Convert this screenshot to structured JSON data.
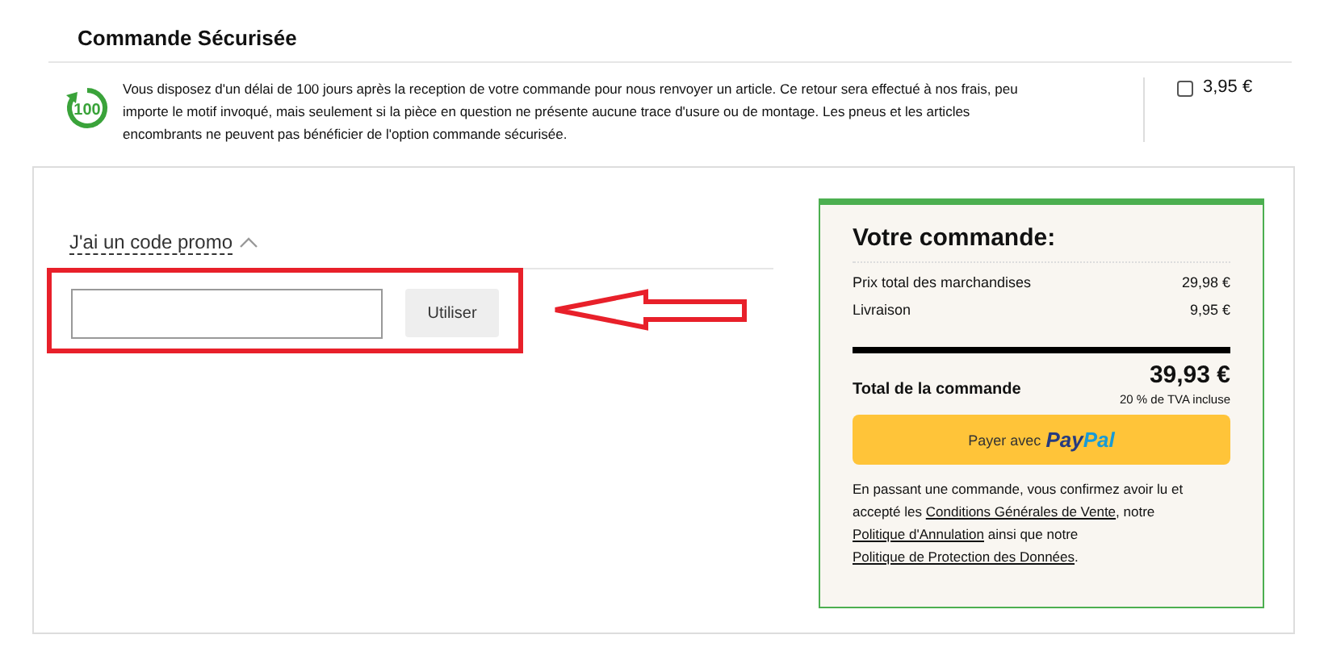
{
  "secure_order": {
    "title": "Commande Sécurisée",
    "badge": "100",
    "description": "Vous disposez d'un délai de 100 jours après la reception de votre commande pour nous renvoyer un article. Ce retour sera effectué à nos frais, peu importe le motif invoqué, mais seulement si la pièce en question ne présente aucune trace d'usure ou de montage. Les pneus et les articles encombrants ne peuvent pas bénéficier de l'option commande sécurisée.",
    "checked": false,
    "price": "3,95 €"
  },
  "promo": {
    "toggle": "J'ai un code promo",
    "expanded": true,
    "button": "Utiliser"
  },
  "summary": {
    "title": "Votre commande:",
    "lines": [
      {
        "label": "Prix total des marchandises",
        "value": "29,98 €"
      },
      {
        "label": "Livraison",
        "value": "9,95 €"
      }
    ],
    "total_label": "Total de la commande",
    "total": "39,93 €",
    "vat": "20 % de TVA incluse",
    "pay_button": {
      "label": "Payer avec",
      "logo": [
        "Pay",
        "Pal"
      ]
    },
    "legal": [
      {
        "kind": "text",
        "text": "En passant une commande, vous confirmez avoir lu et accepté les "
      },
      {
        "kind": "link",
        "text": "Conditions Générales de Vente"
      },
      {
        "kind": "text",
        "text": ", notre "
      },
      {
        "kind": "link",
        "text": "Politique d'Annulation"
      },
      {
        "kind": "text",
        "text": " ainsi que notre "
      },
      {
        "kind": "link",
        "text": "Politique de Protection des Données"
      },
      {
        "kind": "text",
        "text": "."
      }
    ]
  }
}
